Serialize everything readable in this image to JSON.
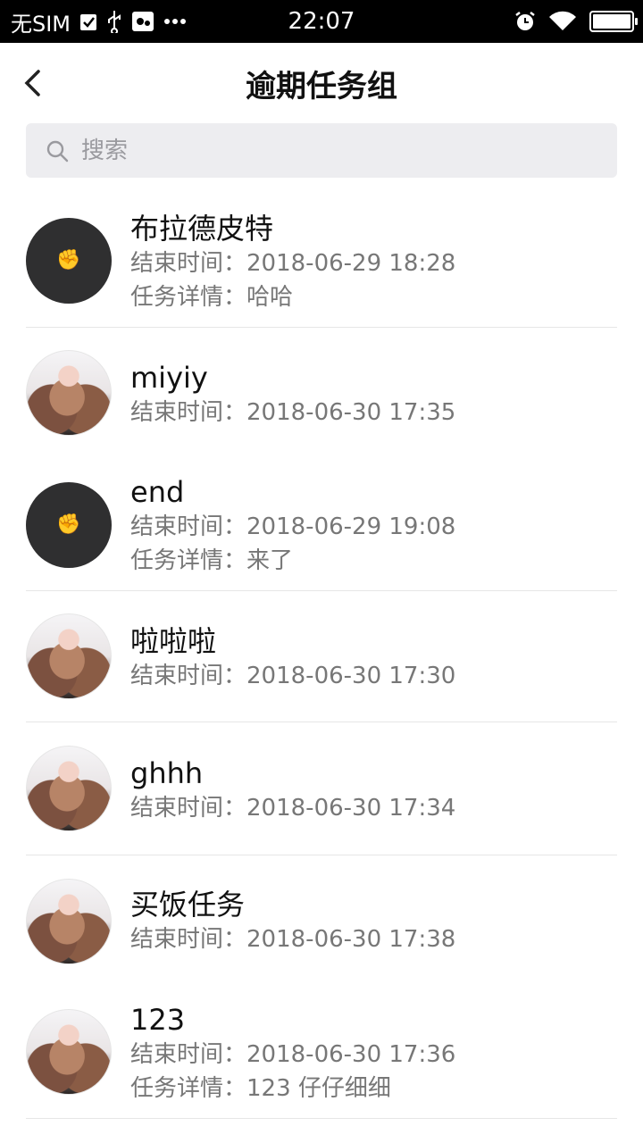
{
  "status_bar": {
    "carrier": "无SIM",
    "time": "22:07",
    "icons_left": [
      "check-box-icon",
      "usb-icon",
      "debug-icon",
      "more-dots-icon"
    ],
    "icons_right": [
      "alarm-icon",
      "wifi-icon",
      "battery-icon"
    ]
  },
  "nav": {
    "title": "逾期任务组",
    "back_icon": "chevron-left-icon"
  },
  "search": {
    "placeholder": "搜索",
    "value": ""
  },
  "end_label": "结束时间：",
  "detail_label": "任务详情：",
  "tasks": [
    {
      "name": "布拉德皮特",
      "end_time": "2018-06-29 18:28",
      "detail": "哈哈",
      "avatar": "fist-icon"
    },
    {
      "name": "miyiy",
      "end_time": "2018-06-30 17:35",
      "detail": null,
      "avatar": "photo"
    },
    {
      "name": "end",
      "end_time": "2018-06-29 19:08",
      "detail": "来了",
      "avatar": "fist-icon"
    },
    {
      "name": "啦啦啦",
      "end_time": "2018-06-30 17:30",
      "detail": null,
      "avatar": "photo"
    },
    {
      "name": "ghhh",
      "end_time": "2018-06-30 17:34",
      "detail": null,
      "avatar": "photo"
    },
    {
      "name": "买饭任务",
      "end_time": "2018-06-30 17:38",
      "detail": null,
      "avatar": "photo"
    },
    {
      "name": "123",
      "end_time": "2018-06-30 17:36",
      "detail": "123 仔仔细细",
      "avatar": "photo"
    }
  ],
  "colors": {
    "status_bar_bg": "#000000",
    "search_bg": "#ededf0",
    "meta_text": "#777777",
    "divider": "#e6e6e6"
  }
}
